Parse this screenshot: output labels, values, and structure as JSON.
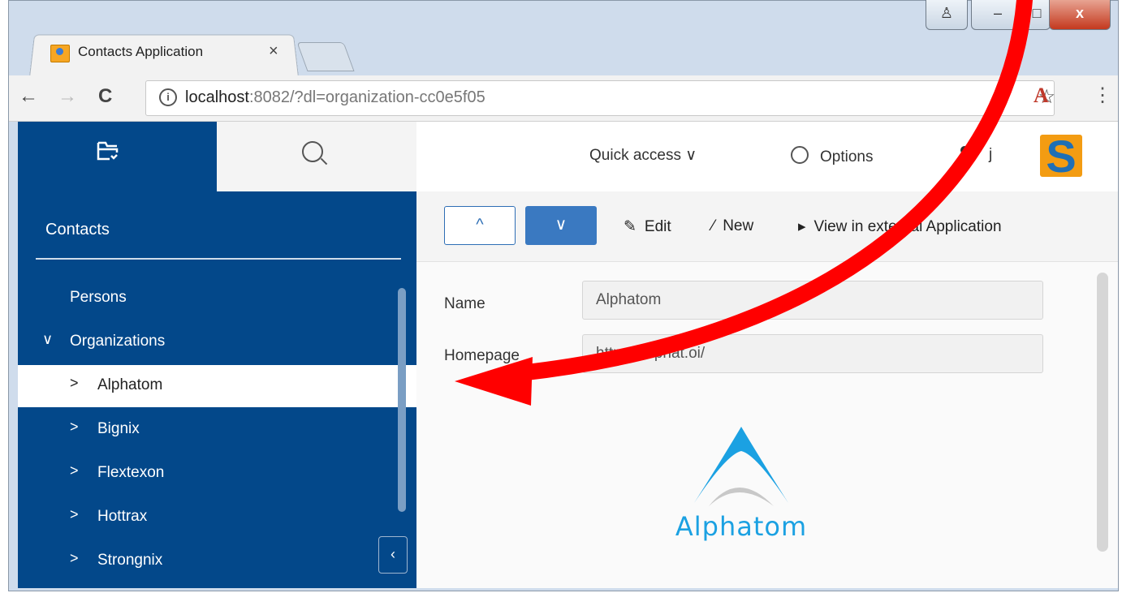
{
  "browser": {
    "tab_title": "Contacts Application",
    "tab_close": "×",
    "url_host": "localhost",
    "url_rest": ":8082/?dl=organization-cc0e5f05",
    "info_glyph": "i",
    "star": "☆",
    "acrobat": "A",
    "menu": "⋮",
    "back": "←",
    "forward": "→",
    "reload": "C"
  },
  "sidebar": {
    "title": "Contacts",
    "items": [
      {
        "label": "Persons",
        "chevron": ""
      },
      {
        "label": "Organizations",
        "chevron": "∨"
      },
      {
        "label": "Alphatom",
        "chevron": ">"
      },
      {
        "label": "Bignix",
        "chevron": ">"
      },
      {
        "label": "Flextexon",
        "chevron": ">"
      },
      {
        "label": "Hottrax",
        "chevron": ">"
      },
      {
        "label": "Strongnix",
        "chevron": ">"
      }
    ],
    "selected": "Alphatom",
    "collapse": "‹"
  },
  "header": {
    "quick_access": "Quick access ∨",
    "options": "Options",
    "user": "j"
  },
  "actions": {
    "up": "^",
    "down": "∨",
    "edit": "Edit",
    "new": "New",
    "view_external": "View in external Application"
  },
  "form": {
    "name_label": "Name",
    "name_value": "Alphatom",
    "homepage_label": "Homepage",
    "homepage_value": "https://alphat.oi/"
  },
  "logo": {
    "company": "Alphatom"
  },
  "colors": {
    "sidebar": "#03488a",
    "accent": "#3a79c1",
    "annotation": "#ff0000"
  }
}
